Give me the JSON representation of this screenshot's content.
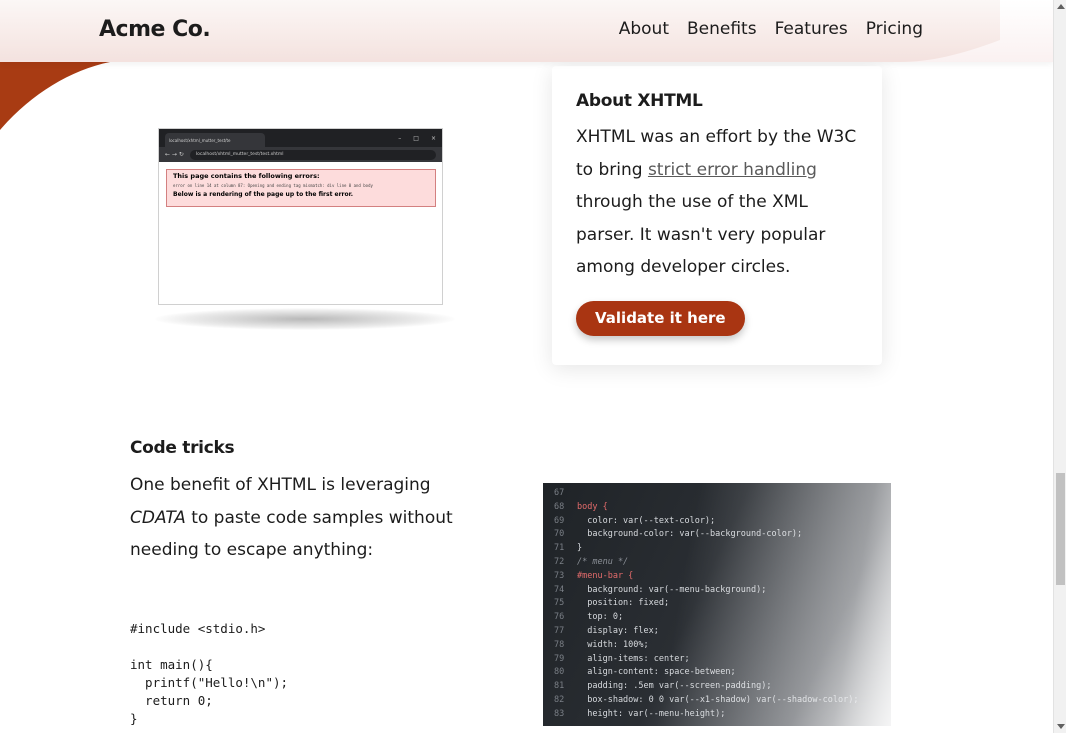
{
  "brand": {
    "name": "Acme Co.",
    "accent": "#a93512",
    "wave_color": "#a83b13"
  },
  "nav": {
    "items": [
      "About",
      "Benefits",
      "Features",
      "Pricing"
    ]
  },
  "browser_shot": {
    "tab_text": "localhost/xhtml_mutter_test/te",
    "url": "localhost/xhtml_mutter_test/test.xhtml",
    "error_title": "This page contains the following errors:",
    "error_detail": "error on line 14 at column 87: Opening and ending tag mismatch: div line 0 and body",
    "error_footer": "Below is a rendering of the page up to the first error."
  },
  "card": {
    "title": "About XHTML",
    "text_before": "XHTML was an effort by the W3C to bring ",
    "link": "strict error handling",
    "text_after": " through the use of the XML parser. It wasn't very popular among developer circles.",
    "cta": "Validate it here"
  },
  "code_tricks": {
    "title": "Code tricks",
    "text_before": "One benefit of XHTML is leveraging ",
    "emphasis": "CDATA",
    "text_after": " to paste code samples without needing to escape anything:",
    "code": "#include <stdio.h>\n\nint main(){\n  printf(\"Hello!\\n\");\n  return 0;\n}"
  },
  "code_image": {
    "lines": [
      {
        "n": "67",
        "t": ""
      },
      {
        "n": "68",
        "t": "body {"
      },
      {
        "n": "69",
        "t": "  color: var(--text-color);"
      },
      {
        "n": "70",
        "t": "  background-color: var(--background-color);"
      },
      {
        "n": "71",
        "t": "}"
      },
      {
        "n": "72",
        "t": "/* menu */"
      },
      {
        "n": "73",
        "t": "#menu-bar {"
      },
      {
        "n": "74",
        "t": "  background: var(--menu-background);"
      },
      {
        "n": "75",
        "t": "  position: fixed;"
      },
      {
        "n": "76",
        "t": "  top: 0;"
      },
      {
        "n": "77",
        "t": "  display: flex;"
      },
      {
        "n": "78",
        "t": "  width: 100%;"
      },
      {
        "n": "79",
        "t": "  align-items: center;"
      },
      {
        "n": "80",
        "t": "  align-content: space-between;"
      },
      {
        "n": "81",
        "t": "  padding: .5em var(--screen-padding);"
      },
      {
        "n": "82",
        "t": "  box-shadow: 0 0 var(--x1-shadow) var(--shadow-color);"
      },
      {
        "n": "83",
        "t": "  height: var(--menu-height);"
      }
    ]
  }
}
